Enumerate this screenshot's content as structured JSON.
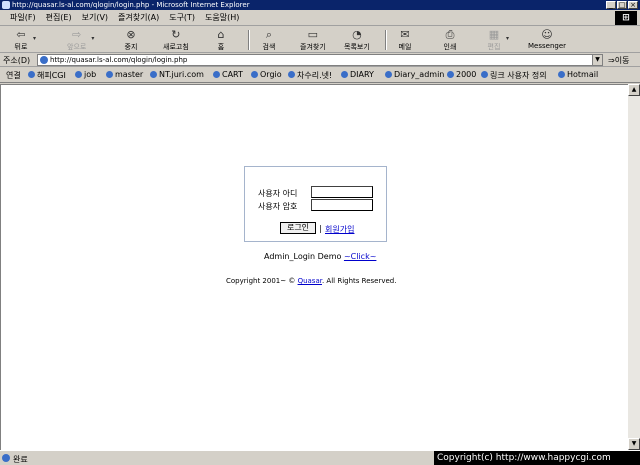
{
  "window": {
    "title": "http://quasar.ls-al.com/qlogin/login.php - Microsoft Internet Explorer"
  },
  "menu": [
    "파일(F)",
    "편집(E)",
    "보기(V)",
    "즐겨찾기(A)",
    "도구(T)",
    "도움말(H)"
  ],
  "toolbar": {
    "back": "뒤로",
    "forward": "앞으로",
    "stop": "중지",
    "refresh": "새로고침",
    "home": "홈",
    "search": "검색",
    "favorites": "즐겨찾기",
    "history": "목록보기",
    "mail": "메일",
    "print": "인쇄",
    "edit": "편집",
    "messenger": "Messenger"
  },
  "address": {
    "label": "주소(D)",
    "url": "http://quasar.ls-al.com/qlogin/login.php",
    "go": "이동"
  },
  "links": {
    "label": "연결",
    "items": [
      "해피CGI",
      "job",
      "master",
      "NT.juri.com",
      "CART",
      "Orgio",
      "차수리.넷!",
      "DIARY",
      "Diary_admin",
      "2000",
      "링크 사용자 정의",
      "Hotmail"
    ]
  },
  "login": {
    "user_id_label": "사용자 아디",
    "password_label": "사용자 암호",
    "user_id_value": "",
    "password_value": "",
    "login_button": "로그인",
    "separator": "|",
    "join_link": "회원가입"
  },
  "demo": {
    "text": "Admin_Login Demo ",
    "click": "~Click~"
  },
  "copyright": {
    "prefix": "Copyright 2001~ © ",
    "link": "Quasar",
    "suffix": ".  All Rights Reserved."
  },
  "status": {
    "text": "완료"
  },
  "watermark": "Copyright(c) http://www.happycgi.com"
}
